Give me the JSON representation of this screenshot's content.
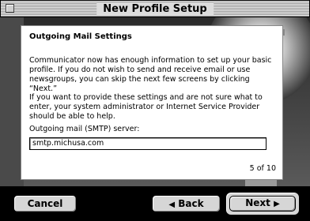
{
  "window": {
    "title": "New Profile Setup"
  },
  "panel": {
    "heading": "Outgoing Mail Settings",
    "paragraph1": "Communicator now has enough information to set up your basic profile. If you do not wish to send and receive email or use newsgroups, you can skip the next few screens by clicking “Next.”",
    "paragraph2": "If you want to provide these settings and are not sure what to enter, your system administrator or Internet Service Provider should be able to help.",
    "smtp_label": "Outgoing mail (SMTP) server:",
    "smtp_value": "smtp.michusa.com",
    "page_indicator": "5 of 10"
  },
  "buttons": {
    "cancel": "Cancel",
    "back": "Back",
    "next": "Next",
    "back_arrow": "◀",
    "next_arrow": "▶"
  }
}
